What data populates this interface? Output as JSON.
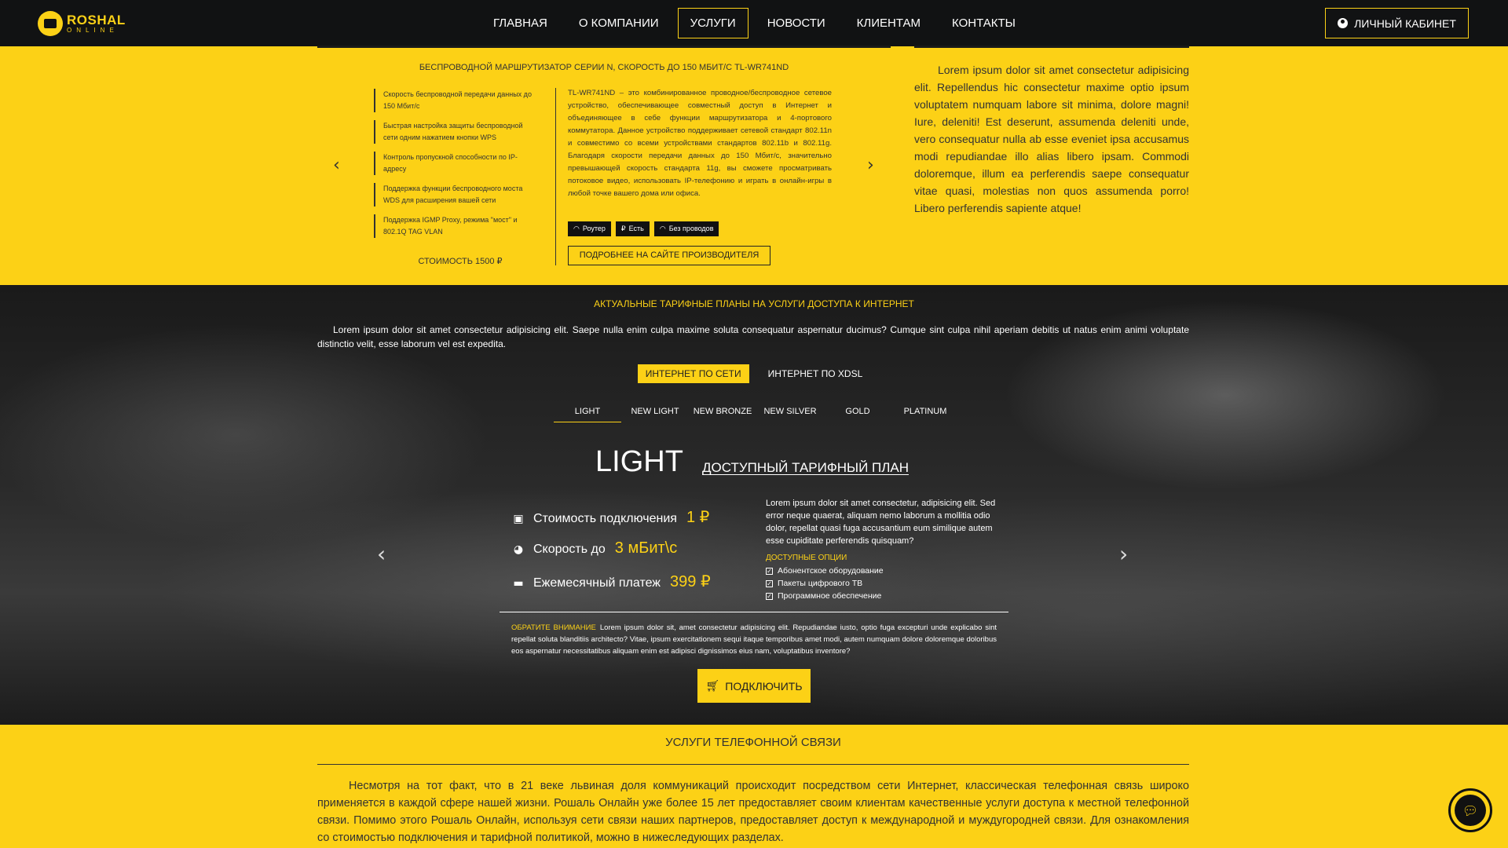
{
  "header": {
    "logo_title": "ROSHAL",
    "logo_sub": "ONLINE",
    "nav": [
      "ГЛАВНАЯ",
      "О КОМПАНИИ",
      "УСЛУГИ",
      "НОВОСТИ",
      "КЛИЕНТАМ",
      "КОНТАКТЫ"
    ],
    "active_nav": "УСЛУГИ",
    "cabinet_label": "ЛИЧНЫЙ КАБИНЕТ"
  },
  "product": {
    "title": "БЕСПРОВОДНОЙ МАРШРУТИЗАТОР СЕРИИ N, СКОРОСТЬ ДО 150 МБИТ/С TL-WR741ND",
    "features": [
      "Скорость беспроводной передачи данных до 150 Мбит/с",
      "Быстрая настройка защиты беспроводной сети одним нажатием кнопки WPS",
      "Контроль пропускной способности по IP-адресу",
      "Поддержка функции беспроводного моста WDS для расширения вашей сети",
      "Поддержка IGMP Proxy, режима \"мост\" и 802.1Q TAG VLAN"
    ],
    "price": "СТОИМОСТЬ 1500 ₽",
    "description": "TL-WR741ND – это комбинированное проводное/беспроводное сетевое устройство, обеспечивающее совместный доступ в Интернет и объединяющее в себе функции маршрутизатора и 4-портового коммутатора. Данное устройство поддерживает сетевой стандарт 802.11n и совместимо со всеми устройствами стандартов 802.11b и 802.11g. Благодаря скорости передачи данных до 150 Мбит/с, значительно превышающей скорость стандарта 11g, вы сможете просматривать потоковое видео, использовать IP-телефонию и играть в онлайн-игры в любой точке вашего дома или офиса.",
    "tags": [
      "Роутер",
      "Есть",
      "Без проводов"
    ],
    "maker_button": "ПОДРОБНЕЕ НА САЙТЕ ПРОИЗВОДИТЕЛЯ",
    "side_text": "Lorem ipsum dolor sit amet consectetur adipisicing elit. Repellendus hic consectetur maxime optio ipsum voluptatem numquam labore sit minima, dolore magni! Iure, deleniti! Est deserunt, assumenda deleniti unde, vero consequatur nulla ab esse eveniet ipsa accusamus modi repudiandae illo alias libero ipsam. Commodi doloremque, illum ea perferendis saepe consequatur vitae quasi, molestias non quos assumenda porro! Libero perferendis sapiente atque!"
  },
  "tariffs": {
    "title": "АКТУАЛЬНЫЕ ТАРИФНЫЕ ПЛАНЫ НА УСЛУГИ ДОСТУПА К ИНТЕРНЕТ",
    "intro": "Lorem ipsum dolor sit amet consectetur adipisicing elit. Saepe nulla enim culpa maxime soluta consequatur aspernatur ducimus? Cumque sint culpa nihil aperiam debitis ut natus enim animi voluptate distinctio velit, esse laborum vel est expedita.",
    "type_tabs": [
      "ИНТЕРНЕТ ПО СЕТИ",
      "ИНТЕРНЕТ ПО XDSL"
    ],
    "plan_tabs": [
      "LIGHT",
      "NEW LIGHT",
      "NEW BRONZE",
      "NEW SILVER",
      "GOLD",
      "PLATINUM"
    ],
    "plan_name": "LIGHT",
    "plan_subtitle": "ДОСТУПНЫЙ ТАРИФНЫЙ ПЛАН",
    "stats": [
      {
        "label": "Стоимость подключения",
        "value": "1 ₽"
      },
      {
        "label": "Скорость до",
        "value": "3 мБит\\с"
      },
      {
        "label": "Ежемесячный платеж",
        "value": "399 ₽"
      }
    ],
    "info_text": "Lorem ipsum dolor sit amet consectetur, adipisicing elit. Sed error neque quaerat, aliquam nemo laborum a mollitia odio dolor, repellat quasi fuga accusantium eum similique autem esse cupiditate perferendis quisquam?",
    "options_title": "ДОСТУПНЫЕ ОПЦИИ",
    "options": [
      "Абонентское оборудование",
      "Пакеты цифрового ТВ",
      "Программное обеспечение"
    ],
    "note_label": "ОБРАТИТЕ ВНИМАНИЕ",
    "note_text": "Lorem ipsum dolor sit, amet consectetur adipisicing elit. Repudiandae iusto, optio fuga excepturi unde explicabo sint repellat soluta blanditiis architecto? Vitae, ipsum exercitationem sequi itaque temporibus amet modi, autem numquam dolore doloremque doloribus eos aspernatur necessitatibus aliquam enim est adipisci dignissimos eius nam, voluptatibus inventore?",
    "connect_button": "ПОДКЛЮЧИТЬ"
  },
  "phone": {
    "title": "УСЛУГИ ТЕЛЕФОННОЙ СВЯЗИ",
    "text": "Несмотря на тот факт, что в 21 веке львиная доля коммуникаций происходит посредством сети Интернет, классическая телефонная связь широко применяется в каждой сфере нашей жизни. Рошаль Онлайн уже более 15 лет предоставляет своим клиентам качественные услуги доступа к местной телефонной связи. Помимо этого Рошаль Онлайн, используя сети связи наших партнеров, предоставляет доступ к международной и муждугородней связи. Для ознакомления со стоимостью подключения и тарифной политикой, можно в нижеследующих разделах."
  },
  "colors": {
    "accent": "#fcd116",
    "header_bg": "#111213"
  }
}
